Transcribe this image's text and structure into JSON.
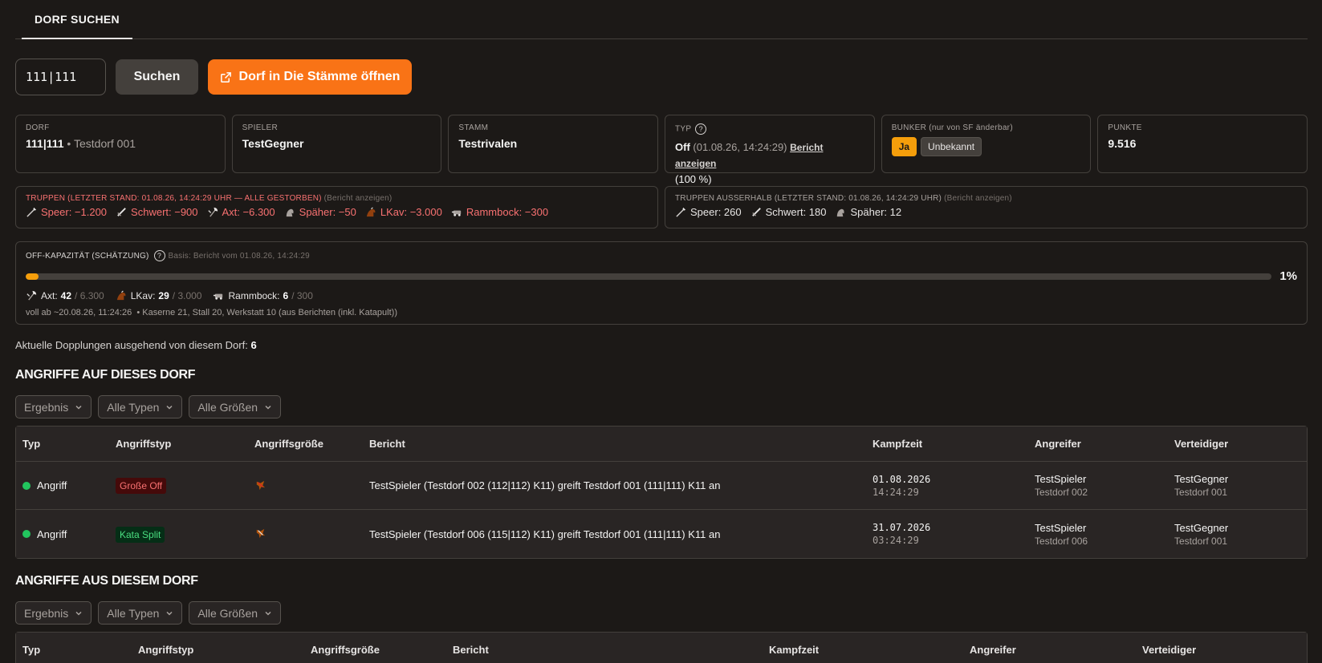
{
  "tabs": {
    "active": "DORF SUCHEN"
  },
  "search": {
    "value": "111|111",
    "search_label": "Suchen",
    "open_label": "Dorf in Die Stämme öffnen"
  },
  "cards": {
    "dorf": {
      "label": "DORF",
      "coord": "111|111",
      "sep": " • ",
      "name": "Testdorf 001"
    },
    "spieler": {
      "label": "SPIELER",
      "value": "TestGegner"
    },
    "stamm": {
      "label": "STAMM",
      "value": "Testrivalen"
    },
    "typ": {
      "label": "TYP",
      "value": "Off",
      "date": "(01.08.26, 14:24:29)",
      "link": "Bericht anzeigen",
      "pct": "(100 %)"
    },
    "bunker": {
      "label": "BUNKER",
      "note": "(nur von SF änderbar)",
      "yes": "Ja",
      "unknown": "Unbekannt"
    },
    "punkte": {
      "label": "PUNKTE",
      "value": "9.516"
    }
  },
  "troops": {
    "title": "TRUPPEN (LETZTER STAND: 01.08.26, 14:24:29 UHR — ALLE GESTORBEN)",
    "aside": "(Bericht anzeigen)",
    "items": [
      {
        "icon": "spear-icon",
        "text": "Speer: −1.200"
      },
      {
        "icon": "sword-icon",
        "text": "Schwert: −900"
      },
      {
        "icon": "axe-icon",
        "text": "Axt: −6.300"
      },
      {
        "icon": "scout-icon",
        "text": "Späher: −50"
      },
      {
        "icon": "light-cavalry-icon",
        "text": "LKav: −3.000"
      },
      {
        "icon": "ram-icon",
        "text": "Rammbock: −300"
      }
    ]
  },
  "troops_outside": {
    "title": "TRUPPEN AUSSERHALB (LETZTER STAND: 01.08.26, 14:24:29 UHR)",
    "aside": "(Bericht anzeigen)",
    "items": [
      {
        "icon": "spear-icon",
        "text": "Speer: 260"
      },
      {
        "icon": "sword-icon",
        "text": "Schwert: 180"
      },
      {
        "icon": "scout-icon",
        "text": "Späher: 12"
      }
    ]
  },
  "off_capacity": {
    "title": "OFF-KAPAZITÄT (SCHÄTZUNG)",
    "basis": "Basis: Bericht vom 01.08.26, 14:24:29",
    "progress_fraction": 0.01,
    "percent": "1%",
    "items": [
      {
        "icon": "axe-icon",
        "label": "Axt:",
        "value": "42",
        "max": " / 6.300"
      },
      {
        "icon": "light-cavalry-icon",
        "label": "LKav:",
        "value": "29",
        "max": " / 3.000"
      },
      {
        "icon": "ram-icon",
        "label": "Rammbock:",
        "value": "6",
        "max": " / 300"
      }
    ],
    "voll": "voll ab ~20.08.26, 11:24:26",
    "voll_detail": "• Kaserne 21, Stall 20, Werkstatt 10 (aus Berichten (inkl. Katapult))"
  },
  "dopplungen": {
    "label": "Aktuelle Dopplungen ausgehend von diesem Dorf:",
    "value": "6"
  },
  "filters": {
    "ergebnis": "Ergebnis",
    "typen": "Alle Typen",
    "groessen": "Alle Größen"
  },
  "attacks_in": {
    "title": "ANGRIFFE AUF DIESES DORF",
    "headers": [
      "Typ",
      "Angriffstyp",
      "Angriffsgröße",
      "Bericht",
      "Kampfzeit",
      "Angreifer",
      "Verteidiger"
    ],
    "rows": [
      {
        "typ": "Angriff",
        "tag": "Große Off",
        "tag_kind": "red",
        "bericht": "TestSpieler (Testdorf 002 (112|112) K11) greift Testdorf 001 (111|111) K11 an",
        "date": "01.08.2026",
        "time": "14:24:29",
        "att": "TestSpieler",
        "att_village": "Testdorf 002",
        "def": "TestGegner",
        "def_village": "Testdorf 001"
      },
      {
        "typ": "Angriff",
        "tag": "Kata Split",
        "tag_kind": "green",
        "bericht": "TestSpieler (Testdorf 006 (115|112) K11) greift Testdorf 001 (111|111) K11 an",
        "date": "31.07.2026",
        "time": "03:24:29",
        "att": "TestSpieler",
        "att_village": "Testdorf 006",
        "def": "TestGegner",
        "def_village": "Testdorf 001"
      }
    ]
  },
  "attacks_out": {
    "title": "ANGRIFFE AUS DIESEM DORF",
    "headers": [
      "Typ",
      "Angriffstyp",
      "Angriffsgröße",
      "Bericht",
      "Kampfzeit",
      "Angreifer",
      "Verteidiger"
    ]
  }
}
